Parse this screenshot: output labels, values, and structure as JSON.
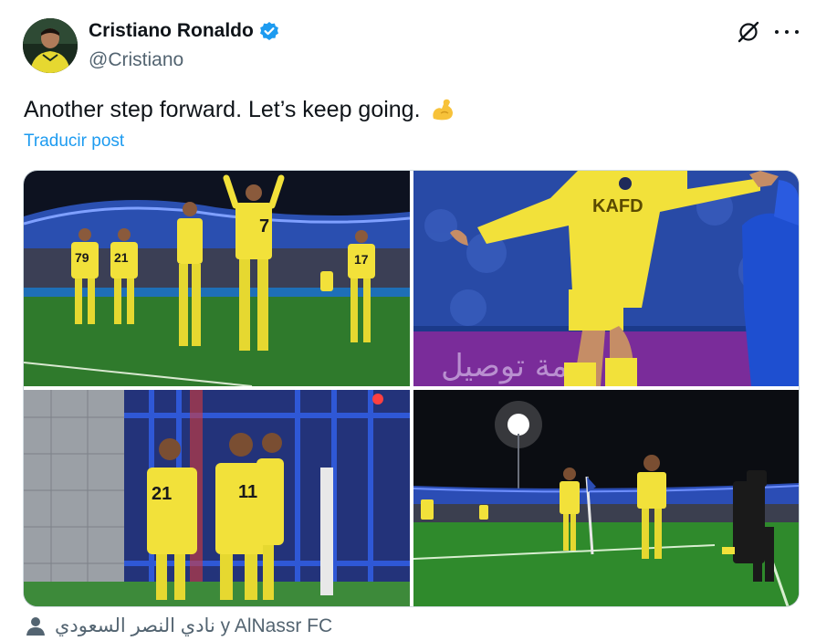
{
  "author": {
    "display_name": "Cristiano Ronaldo",
    "handle": "@Cristiano",
    "verified": true
  },
  "tweet": {
    "text": "Another step forward. Let’s keep going.",
    "emoji": "flexed-biceps",
    "translate_label": "Traducir post"
  },
  "media": {
    "photos": [
      {
        "name": "team-celebration-photo"
      },
      {
        "name": "ronaldo-celebration-closeup-photo"
      },
      {
        "name": "teammates-hugging-photo"
      },
      {
        "name": "night-stadium-corner-photo"
      }
    ],
    "photo_text": {
      "jersey_79": "79",
      "jersey_21": "21",
      "jersey_7": "7",
      "jersey_17": "17",
      "jersey_11": "11",
      "jersey_21b": "21",
      "sponsor_kafd": "KAFD",
      "banner_arabic": "خدمة توصيل"
    }
  },
  "tagged": {
    "text": "نادي النصر السعودي y AlNassr FC",
    "icon": "person-icon"
  },
  "colors": {
    "link": "#1d9bf0",
    "verified": "#1d9bf0",
    "jersey": "#f2e13a",
    "pitch": "#2f7a2c"
  }
}
